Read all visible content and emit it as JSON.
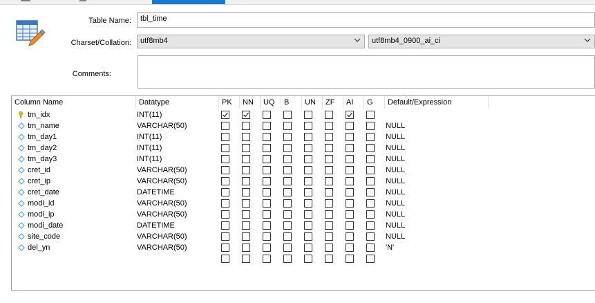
{
  "form": {
    "table_name_label": "Table Name:",
    "table_name_value": "tbl_time",
    "charset_label": "Charset/Collation:",
    "charset_value": "utf8mb4",
    "collation_value": "utf8mb4_0900_ai_ci",
    "comments_label": "Comments:",
    "comments_value": ""
  },
  "grid": {
    "headers": {
      "column_name": "Column Name",
      "datatype": "Datatype",
      "pk": "PK",
      "nn": "NN",
      "uq": "UQ",
      "b": "B",
      "un": "UN",
      "zf": "ZF",
      "ai": "AI",
      "g": "G",
      "default": "Default/Expression"
    },
    "rows": [
      {
        "name": "tm_idx",
        "type": "INT(11)",
        "key": true,
        "pk": true,
        "nn": true,
        "uq": false,
        "b": false,
        "un": false,
        "zf": false,
        "ai": true,
        "g": false,
        "default": ""
      },
      {
        "name": "tm_name",
        "type": "VARCHAR(50)",
        "key": false,
        "pk": false,
        "nn": false,
        "uq": false,
        "b": false,
        "un": false,
        "zf": false,
        "ai": false,
        "g": false,
        "default": "NULL"
      },
      {
        "name": "tm_day1",
        "type": "INT(11)",
        "key": false,
        "pk": false,
        "nn": false,
        "uq": false,
        "b": false,
        "un": false,
        "zf": false,
        "ai": false,
        "g": false,
        "default": "NULL"
      },
      {
        "name": "tm_day2",
        "type": "INT(11)",
        "key": false,
        "pk": false,
        "nn": false,
        "uq": false,
        "b": false,
        "un": false,
        "zf": false,
        "ai": false,
        "g": false,
        "default": "NULL"
      },
      {
        "name": "tm_day3",
        "type": "INT(11)",
        "key": false,
        "pk": false,
        "nn": false,
        "uq": false,
        "b": false,
        "un": false,
        "zf": false,
        "ai": false,
        "g": false,
        "default": "NULL"
      },
      {
        "name": "cret_id",
        "type": "VARCHAR(50)",
        "key": false,
        "pk": false,
        "nn": false,
        "uq": false,
        "b": false,
        "un": false,
        "zf": false,
        "ai": false,
        "g": false,
        "default": "NULL"
      },
      {
        "name": "cret_ip",
        "type": "VARCHAR(50)",
        "key": false,
        "pk": false,
        "nn": false,
        "uq": false,
        "b": false,
        "un": false,
        "zf": false,
        "ai": false,
        "g": false,
        "default": "NULL"
      },
      {
        "name": "cret_date",
        "type": "DATETIME",
        "key": false,
        "pk": false,
        "nn": false,
        "uq": false,
        "b": false,
        "un": false,
        "zf": false,
        "ai": false,
        "g": false,
        "default": "NULL"
      },
      {
        "name": "modi_id",
        "type": "VARCHAR(50)",
        "key": false,
        "pk": false,
        "nn": false,
        "uq": false,
        "b": false,
        "un": false,
        "zf": false,
        "ai": false,
        "g": false,
        "default": "NULL"
      },
      {
        "name": "modi_ip",
        "type": "VARCHAR(50)",
        "key": false,
        "pk": false,
        "nn": false,
        "uq": false,
        "b": false,
        "un": false,
        "zf": false,
        "ai": false,
        "g": false,
        "default": "NULL"
      },
      {
        "name": "modi_date",
        "type": "DATETIME",
        "key": false,
        "pk": false,
        "nn": false,
        "uq": false,
        "b": false,
        "un": false,
        "zf": false,
        "ai": false,
        "g": false,
        "default": "NULL"
      },
      {
        "name": "site_code",
        "type": "VARCHAR(50)",
        "key": false,
        "pk": false,
        "nn": false,
        "uq": false,
        "b": false,
        "un": false,
        "zf": false,
        "ai": false,
        "g": false,
        "default": "NULL"
      },
      {
        "name": "del_yn",
        "type": "VARCHAR(50)",
        "key": false,
        "pk": false,
        "nn": false,
        "uq": false,
        "b": false,
        "un": false,
        "zf": false,
        "ai": false,
        "g": false,
        "default": "'N'"
      },
      {
        "name": "",
        "type": "",
        "key": null,
        "pk": false,
        "nn": false,
        "uq": false,
        "b": false,
        "un": false,
        "zf": false,
        "ai": false,
        "g": false,
        "default": ""
      }
    ]
  },
  "icons": {
    "table": "table-edit-icon",
    "primary_key": "key-icon",
    "column": "diamond-icon",
    "dropdown": "chevron-down-icon"
  },
  "colors": {
    "active_tab": "#1979ca",
    "key": "#f2c200",
    "column_diamond": "#5aa7d8"
  }
}
